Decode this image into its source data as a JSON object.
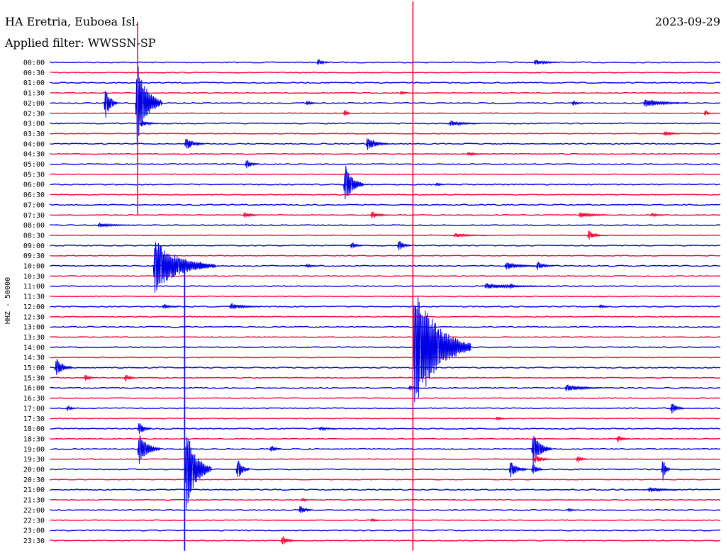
{
  "header": {
    "station": "HA Eretria, Euboea Isl.",
    "date": "2023-09-29",
    "filter": "Applied filter: WWSSN-SP"
  },
  "colors": {
    "blue": "#0000e6",
    "red": "#ff0033",
    "background": "#ffffff",
    "text": "#000000"
  },
  "chart_data": {
    "type": "helicorder",
    "ylabel": "HHZ - 50000",
    "row_labels": [
      "00:00",
      "00:30",
      "01:00",
      "01:30",
      "02:00",
      "02:30",
      "03:00",
      "03:30",
      "04:00",
      "04:30",
      "05:00",
      "05:30",
      "06:00",
      "06:30",
      "07:00",
      "07:30",
      "08:00",
      "08:30",
      "09:00",
      "09:30",
      "10:00",
      "10:30",
      "11:00",
      "11:30",
      "12:00",
      "12:30",
      "13:00",
      "13:30",
      "14:00",
      "14:30",
      "15:00",
      "15:30",
      "16:00",
      "16:30",
      "17:00",
      "17:30",
      "18:00",
      "18:30",
      "19:00",
      "19:30",
      "20:00",
      "20:30",
      "21:00",
      "21:30",
      "22:00",
      "22:30",
      "23:00",
      "23:30"
    ],
    "row_minutes": 30,
    "events": [
      {
        "row": 0,
        "minute": 11.9,
        "amp": 5,
        "dur": 0.6
      },
      {
        "row": 0,
        "minute": 21.6,
        "amp": 4,
        "dur": 1.2
      },
      {
        "row": 3,
        "minute": 15.6,
        "amp": 3,
        "dur": 0.4
      },
      {
        "row": 4,
        "minute": 2.4,
        "amp": 24,
        "dur": 0.6
      },
      {
        "row": 4,
        "minute": 3.8,
        "amp": 60,
        "dur": 1.2
      },
      {
        "row": 4,
        "minute": 11.4,
        "amp": 3,
        "dur": 0.6
      },
      {
        "row": 4,
        "minute": 23.3,
        "amp": 4,
        "dur": 0.5
      },
      {
        "row": 4,
        "minute": 26.5,
        "amp": 6,
        "dur": 2.0
      },
      {
        "row": 5,
        "minute": 13.1,
        "amp": 6,
        "dur": 0.3
      },
      {
        "row": 5,
        "minute": 29.2,
        "amp": 5,
        "dur": 0.3
      },
      {
        "row": 6,
        "minute": 4.0,
        "amp": 5,
        "dur": 0.8
      },
      {
        "row": 6,
        "minute": 17.8,
        "amp": 4,
        "dur": 1.4
      },
      {
        "row": 7,
        "minute": 27.4,
        "amp": 4,
        "dur": 0.8
      },
      {
        "row": 8,
        "minute": 6.0,
        "amp": 9,
        "dur": 0.9
      },
      {
        "row": 8,
        "minute": 14.1,
        "amp": 10,
        "dur": 1.0
      },
      {
        "row": 9,
        "minute": 18.6,
        "amp": 3,
        "dur": 0.8
      },
      {
        "row": 10,
        "minute": 8.7,
        "amp": 7,
        "dur": 0.6
      },
      {
        "row": 12,
        "minute": 13.1,
        "amp": 30,
        "dur": 0.9
      },
      {
        "row": 12,
        "minute": 17.2,
        "amp": 3,
        "dur": 0.4
      },
      {
        "row": 15,
        "minute": 8.6,
        "amp": 5,
        "dur": 0.7
      },
      {
        "row": 15,
        "minute": 14.3,
        "amp": 5,
        "dur": 0.8
      },
      {
        "row": 15,
        "minute": 23.6,
        "amp": 4,
        "dur": 1.4
      },
      {
        "row": 15,
        "minute": 26.8,
        "amp": 3,
        "dur": 0.7
      },
      {
        "row": 16,
        "minute": 2.1,
        "amp": 3,
        "dur": 1.8
      },
      {
        "row": 17,
        "minute": 18.0,
        "amp": 3,
        "dur": 1.5
      },
      {
        "row": 17,
        "minute": 24.0,
        "amp": 9,
        "dur": 0.6
      },
      {
        "row": 18,
        "minute": 13.4,
        "amp": 5,
        "dur": 0.6
      },
      {
        "row": 18,
        "minute": 15.5,
        "amp": 8,
        "dur": 0.6
      },
      {
        "row": 20,
        "minute": 4.6,
        "amp": 40,
        "dur": 2.8
      },
      {
        "row": 20,
        "minute": 6.6,
        "amp": 7,
        "dur": 0.7
      },
      {
        "row": 20,
        "minute": 11.4,
        "amp": 3,
        "dur": 0.6
      },
      {
        "row": 20,
        "minute": 20.3,
        "amp": 6,
        "dur": 1.4
      },
      {
        "row": 20,
        "minute": 21.7,
        "amp": 6,
        "dur": 0.8
      },
      {
        "row": 22,
        "minute": 19.4,
        "amp": 4,
        "dur": 3.0
      },
      {
        "row": 22,
        "minute": 20.5,
        "amp": 5,
        "dur": 0.3
      },
      {
        "row": 24,
        "minute": 5.0,
        "amp": 4,
        "dur": 0.8
      },
      {
        "row": 24,
        "minute": 8.0,
        "amp": 5,
        "dur": 1.4
      },
      {
        "row": 24,
        "minute": 24.5,
        "amp": 3,
        "dur": 0.5
      },
      {
        "row": 28,
        "minute": 16.2,
        "amp": 100,
        "dur": 2.6
      },
      {
        "row": 30,
        "minute": 0.2,
        "amp": 14,
        "dur": 0.8
      },
      {
        "row": 31,
        "minute": 1.5,
        "amp": 5,
        "dur": 0.5
      },
      {
        "row": 31,
        "minute": 3.3,
        "amp": 6,
        "dur": 0.5
      },
      {
        "row": 32,
        "minute": 16.0,
        "amp": 4,
        "dur": 0.5
      },
      {
        "row": 32,
        "minute": 23.0,
        "amp": 6,
        "dur": 1.6
      },
      {
        "row": 34,
        "minute": 0.7,
        "amp": 4,
        "dur": 0.5
      },
      {
        "row": 34,
        "minute": 27.7,
        "amp": 9,
        "dur": 0.6
      },
      {
        "row": 35,
        "minute": 19.9,
        "amp": 3,
        "dur": 0.4
      },
      {
        "row": 36,
        "minute": 3.9,
        "amp": 10,
        "dur": 0.6
      },
      {
        "row": 36,
        "minute": 12.0,
        "amp": 3,
        "dur": 0.8
      },
      {
        "row": 37,
        "minute": 25.3,
        "amp": 5,
        "dur": 0.6
      },
      {
        "row": 38,
        "minute": 3.9,
        "amp": 24,
        "dur": 1.0
      },
      {
        "row": 38,
        "minute": 9.8,
        "amp": 6,
        "dur": 0.5
      },
      {
        "row": 38,
        "minute": 21.5,
        "amp": 24,
        "dur": 0.9
      },
      {
        "row": 39,
        "minute": 21.6,
        "amp": 6,
        "dur": 0.8
      },
      {
        "row": 39,
        "minute": 23.5,
        "amp": 5,
        "dur": 0.5
      },
      {
        "row": 40,
        "minute": 6.0,
        "amp": 60,
        "dur": 1.2
      },
      {
        "row": 40,
        "minute": 8.3,
        "amp": 16,
        "dur": 0.6
      },
      {
        "row": 40,
        "minute": 20.5,
        "amp": 12,
        "dur": 0.8
      },
      {
        "row": 40,
        "minute": 21.5,
        "amp": 10,
        "dur": 0.5
      },
      {
        "row": 40,
        "minute": 27.3,
        "amp": 16,
        "dur": 0.4
      },
      {
        "row": 42,
        "minute": 26.7,
        "amp": 4,
        "dur": 1.4
      },
      {
        "row": 43,
        "minute": 11.2,
        "amp": 3,
        "dur": 0.4
      },
      {
        "row": 44,
        "minute": 11.1,
        "amp": 7,
        "dur": 0.6
      },
      {
        "row": 44,
        "minute": 23.1,
        "amp": 3,
        "dur": 0.4
      },
      {
        "row": 45,
        "minute": 14.3,
        "amp": 3,
        "dur": 0.4
      },
      {
        "row": 47,
        "minute": 10.3,
        "amp": 8,
        "dur": 0.6
      }
    ],
    "long_spikes": [
      {
        "minute": 3.9,
        "color": "red",
        "top_row": -4,
        "bottom_row": 15
      },
      {
        "minute": 6.0,
        "color": "blue",
        "top_row": 20,
        "bottom_row": 48
      },
      {
        "minute": 16.2,
        "color": "red",
        "top_row": -6,
        "bottom_row": 48
      }
    ]
  }
}
